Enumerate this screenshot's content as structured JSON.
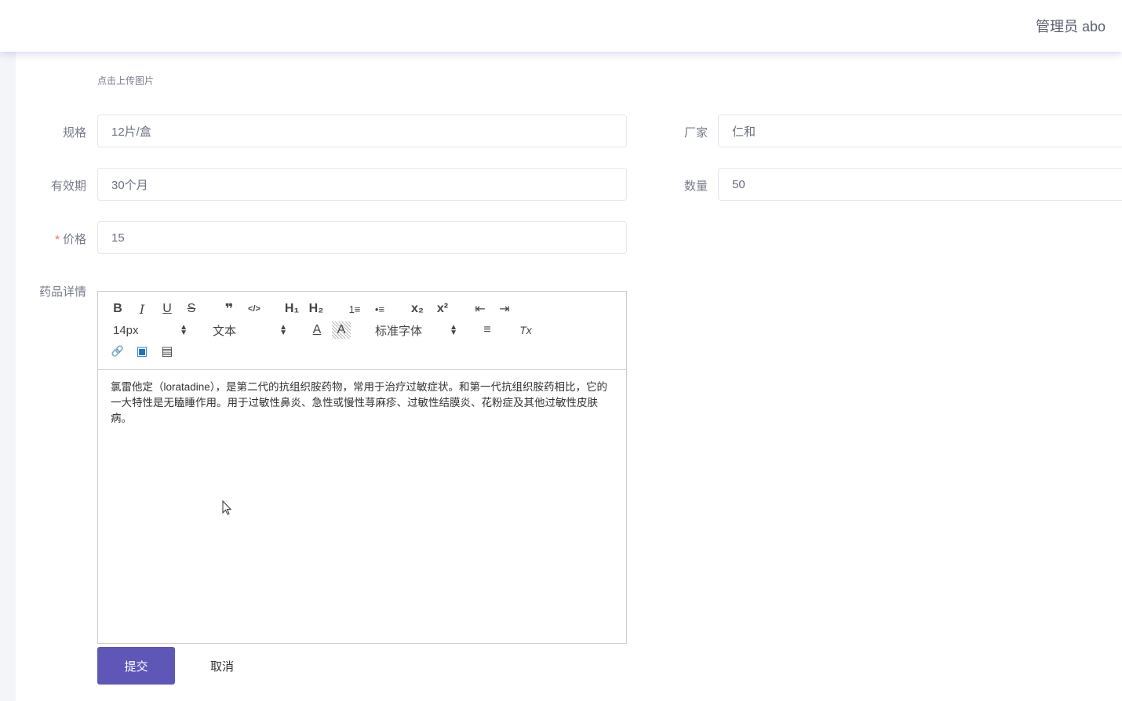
{
  "header": {
    "user": "管理员 abo"
  },
  "upload": {
    "hint": "点击上传图片"
  },
  "form": {
    "spec": {
      "label": "规格",
      "value": "12片/盒"
    },
    "manufacturer": {
      "label": "厂家",
      "value": "仁和"
    },
    "validity": {
      "label": "有效期",
      "value": "30个月"
    },
    "quantity": {
      "label": "数量",
      "value": "50"
    },
    "price": {
      "required": "*",
      "label": "价格",
      "value": "15"
    },
    "detail": {
      "label": "药品详情"
    }
  },
  "editor": {
    "toolbar": {
      "bold": "B",
      "italic": "I",
      "underline": "U",
      "strike": "S",
      "quote": "❞",
      "code": "</>",
      "h1": "H₁",
      "h2": "H₂",
      "ordered_list": "1≡",
      "bullet_list": "•≡",
      "subscript": "x₂",
      "superscript": "x²",
      "outdent": "⇤",
      "indent": "⇥",
      "size": "14px",
      "header": "文本",
      "font": "标准字体",
      "text_color": "A",
      "background": "A",
      "align": "≡",
      "clean": "Tx",
      "link": "🔗",
      "image": "▣",
      "video": "▤"
    },
    "content": "氯雷他定（loratadine），是第二代的抗组织胺药物，常用于治疗过敏症状。和第一代抗组织胺药相比，它的一大特性是无瞌睡作用。用于过敏性鼻炎、急性或慢性荨麻疹、过敏性结膜炎、花粉症及其他过敏性皮肤病。"
  },
  "actions": {
    "submit": "提交",
    "cancel": "取消"
  },
  "colors": {
    "accent": "#5f57b8",
    "required": "#f56c6c"
  }
}
